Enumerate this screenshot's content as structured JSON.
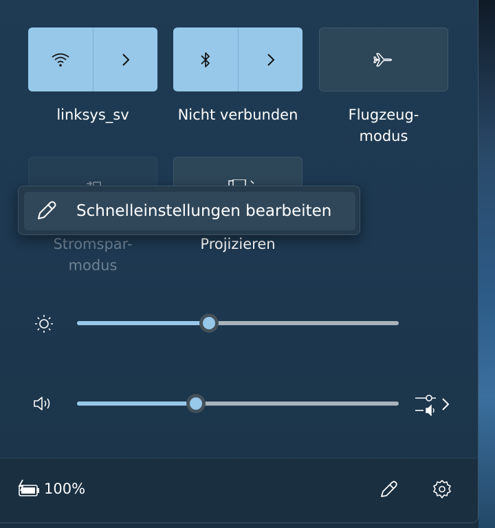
{
  "tiles": [
    {
      "label": "linksys_sv",
      "icon": "wifi-icon",
      "state": "on"
    },
    {
      "label": "Nicht verbunden",
      "icon": "bluetooth-icon",
      "state": "on"
    },
    {
      "label_line1": "Flugzeug-",
      "label_line2": "modus",
      "icon": "airplane-icon",
      "state": "off"
    },
    {
      "label_line1": "Stromspar-",
      "label_line2": "modus",
      "icon": "battery-saver-icon",
      "state": "disabled"
    },
    {
      "label": "Projizieren",
      "icon": "project-icon",
      "state": "disabled"
    }
  ],
  "context_menu": {
    "item_label": "Schnelleinstellungen bearbeiten",
    "icon": "pencil-icon"
  },
  "sliders": {
    "brightness": {
      "icon": "sun-icon",
      "level": 0.41
    },
    "volume": {
      "icon": "speaker-icon",
      "level": 0.37,
      "mixer_icon": "volume-mixer-icon"
    }
  },
  "footer": {
    "battery_icon": "battery-charging-icon",
    "battery_text": "100%",
    "edit_icon": "pencil-icon",
    "settings_icon": "gear-icon"
  },
  "colors": {
    "accent": "#97c8ea",
    "panel": "#1e3b53",
    "tile_off": "#2d4658"
  }
}
